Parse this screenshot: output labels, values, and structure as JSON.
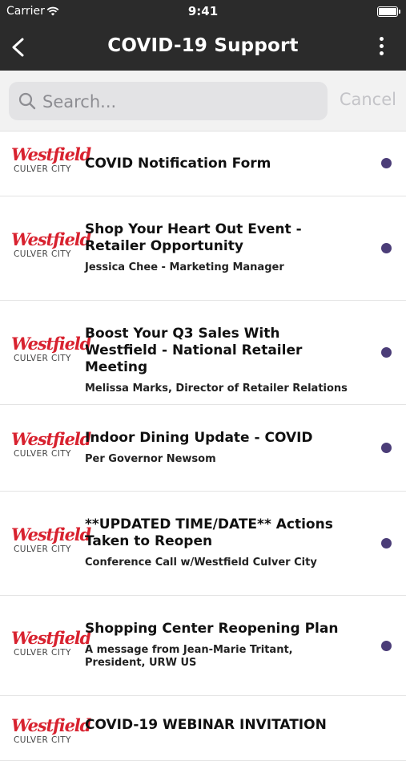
{
  "status_bar": {
    "carrier": "Carrier",
    "time": "9:41"
  },
  "nav": {
    "title": "COVID-19 Support",
    "back_icon": "chevron-left-icon",
    "more_icon": "more-vertical-icon"
  },
  "search": {
    "placeholder": "Search...",
    "value": "",
    "cancel_label": "Cancel"
  },
  "logo": {
    "script": "Westfield",
    "subtitle": "CULVER CITY",
    "color": "#d8222f"
  },
  "unread_dot_color": "#4b3d78",
  "items": [
    {
      "title": "COVID Notification Form",
      "subtitle": ""
    },
    {
      "title": "Shop Your Heart Out Event - Retailer Opportunity",
      "subtitle": "Jessica Chee - Marketing Manager"
    },
    {
      "title": "Boost Your Q3 Sales With Westfield - National Retailer Meeting",
      "subtitle": "Melissa Marks, Director of Retailer Relations"
    },
    {
      "title": "Indoor Dining Update - COVID",
      "subtitle": "Per Governor Newsom"
    },
    {
      "title": "**UPDATED TIME/DATE** Actions Taken to Reopen",
      "subtitle": "Conference Call w/Westfield Culver City"
    },
    {
      "title": "Shopping Center Reopening Plan",
      "subtitle": "A message from Jean-Marie Tritant, President, URW US"
    },
    {
      "title": "COVID-19 WEBINAR INVITATION",
      "subtitle": ""
    }
  ]
}
